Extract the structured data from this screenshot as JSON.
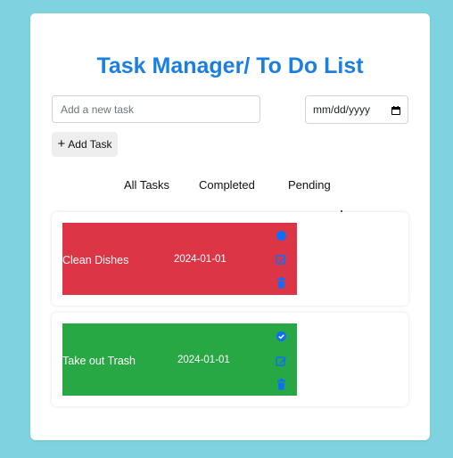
{
  "header": {
    "title": "Task Manager/ To Do List"
  },
  "form": {
    "task_placeholder": "Add a new task",
    "date_placeholder": "mm/dd/yyyy",
    "add_button_icon": "plus",
    "add_button_label": "Add Task"
  },
  "filters": [
    {
      "label": "All Tasks"
    },
    {
      "label": "Completed"
    },
    {
      "label": "Pending"
    }
  ],
  "tasks": [
    {
      "name": "Clean Dishes",
      "date": "2024-01-01",
      "status": "pending",
      "color": "#dc3545",
      "status_icon": "circle-icon",
      "edit_icon": "edit-icon",
      "delete_icon": "trash-icon"
    },
    {
      "name": "Take out Trash",
      "date": "2024-01-01",
      "status": "completed",
      "color": "#28a745",
      "status_icon": "check-circle-icon",
      "edit_icon": "edit-icon",
      "delete_icon": "trash-icon"
    }
  ],
  "colors": {
    "background": "#7fd3e0",
    "title": "#1a7fe0",
    "icon": "#0d6efd",
    "pending": "#dc3545",
    "completed": "#28a745"
  }
}
